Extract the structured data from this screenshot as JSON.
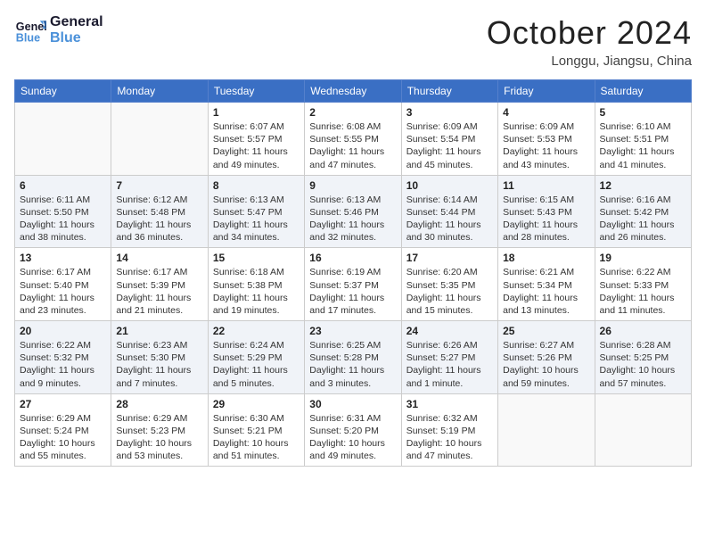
{
  "header": {
    "logo_line1": "General",
    "logo_line2": "Blue",
    "month": "October 2024",
    "location": "Longgu, Jiangsu, China"
  },
  "days_of_week": [
    "Sunday",
    "Monday",
    "Tuesday",
    "Wednesday",
    "Thursday",
    "Friday",
    "Saturday"
  ],
  "weeks": [
    [
      {
        "day": "",
        "info": ""
      },
      {
        "day": "",
        "info": ""
      },
      {
        "day": "1",
        "info": "Sunrise: 6:07 AM\nSunset: 5:57 PM\nDaylight: 11 hours and 49 minutes."
      },
      {
        "day": "2",
        "info": "Sunrise: 6:08 AM\nSunset: 5:55 PM\nDaylight: 11 hours and 47 minutes."
      },
      {
        "day": "3",
        "info": "Sunrise: 6:09 AM\nSunset: 5:54 PM\nDaylight: 11 hours and 45 minutes."
      },
      {
        "day": "4",
        "info": "Sunrise: 6:09 AM\nSunset: 5:53 PM\nDaylight: 11 hours and 43 minutes."
      },
      {
        "day": "5",
        "info": "Sunrise: 6:10 AM\nSunset: 5:51 PM\nDaylight: 11 hours and 41 minutes."
      }
    ],
    [
      {
        "day": "6",
        "info": "Sunrise: 6:11 AM\nSunset: 5:50 PM\nDaylight: 11 hours and 38 minutes."
      },
      {
        "day": "7",
        "info": "Sunrise: 6:12 AM\nSunset: 5:48 PM\nDaylight: 11 hours and 36 minutes."
      },
      {
        "day": "8",
        "info": "Sunrise: 6:13 AM\nSunset: 5:47 PM\nDaylight: 11 hours and 34 minutes."
      },
      {
        "day": "9",
        "info": "Sunrise: 6:13 AM\nSunset: 5:46 PM\nDaylight: 11 hours and 32 minutes."
      },
      {
        "day": "10",
        "info": "Sunrise: 6:14 AM\nSunset: 5:44 PM\nDaylight: 11 hours and 30 minutes."
      },
      {
        "day": "11",
        "info": "Sunrise: 6:15 AM\nSunset: 5:43 PM\nDaylight: 11 hours and 28 minutes."
      },
      {
        "day": "12",
        "info": "Sunrise: 6:16 AM\nSunset: 5:42 PM\nDaylight: 11 hours and 26 minutes."
      }
    ],
    [
      {
        "day": "13",
        "info": "Sunrise: 6:17 AM\nSunset: 5:40 PM\nDaylight: 11 hours and 23 minutes."
      },
      {
        "day": "14",
        "info": "Sunrise: 6:17 AM\nSunset: 5:39 PM\nDaylight: 11 hours and 21 minutes."
      },
      {
        "day": "15",
        "info": "Sunrise: 6:18 AM\nSunset: 5:38 PM\nDaylight: 11 hours and 19 minutes."
      },
      {
        "day": "16",
        "info": "Sunrise: 6:19 AM\nSunset: 5:37 PM\nDaylight: 11 hours and 17 minutes."
      },
      {
        "day": "17",
        "info": "Sunrise: 6:20 AM\nSunset: 5:35 PM\nDaylight: 11 hours and 15 minutes."
      },
      {
        "day": "18",
        "info": "Sunrise: 6:21 AM\nSunset: 5:34 PM\nDaylight: 11 hours and 13 minutes."
      },
      {
        "day": "19",
        "info": "Sunrise: 6:22 AM\nSunset: 5:33 PM\nDaylight: 11 hours and 11 minutes."
      }
    ],
    [
      {
        "day": "20",
        "info": "Sunrise: 6:22 AM\nSunset: 5:32 PM\nDaylight: 11 hours and 9 minutes."
      },
      {
        "day": "21",
        "info": "Sunrise: 6:23 AM\nSunset: 5:30 PM\nDaylight: 11 hours and 7 minutes."
      },
      {
        "day": "22",
        "info": "Sunrise: 6:24 AM\nSunset: 5:29 PM\nDaylight: 11 hours and 5 minutes."
      },
      {
        "day": "23",
        "info": "Sunrise: 6:25 AM\nSunset: 5:28 PM\nDaylight: 11 hours and 3 minutes."
      },
      {
        "day": "24",
        "info": "Sunrise: 6:26 AM\nSunset: 5:27 PM\nDaylight: 11 hours and 1 minute."
      },
      {
        "day": "25",
        "info": "Sunrise: 6:27 AM\nSunset: 5:26 PM\nDaylight: 10 hours and 59 minutes."
      },
      {
        "day": "26",
        "info": "Sunrise: 6:28 AM\nSunset: 5:25 PM\nDaylight: 10 hours and 57 minutes."
      }
    ],
    [
      {
        "day": "27",
        "info": "Sunrise: 6:29 AM\nSunset: 5:24 PM\nDaylight: 10 hours and 55 minutes."
      },
      {
        "day": "28",
        "info": "Sunrise: 6:29 AM\nSunset: 5:23 PM\nDaylight: 10 hours and 53 minutes."
      },
      {
        "day": "29",
        "info": "Sunrise: 6:30 AM\nSunset: 5:21 PM\nDaylight: 10 hours and 51 minutes."
      },
      {
        "day": "30",
        "info": "Sunrise: 6:31 AM\nSunset: 5:20 PM\nDaylight: 10 hours and 49 minutes."
      },
      {
        "day": "31",
        "info": "Sunrise: 6:32 AM\nSunset: 5:19 PM\nDaylight: 10 hours and 47 minutes."
      },
      {
        "day": "",
        "info": ""
      },
      {
        "day": "",
        "info": ""
      }
    ]
  ]
}
